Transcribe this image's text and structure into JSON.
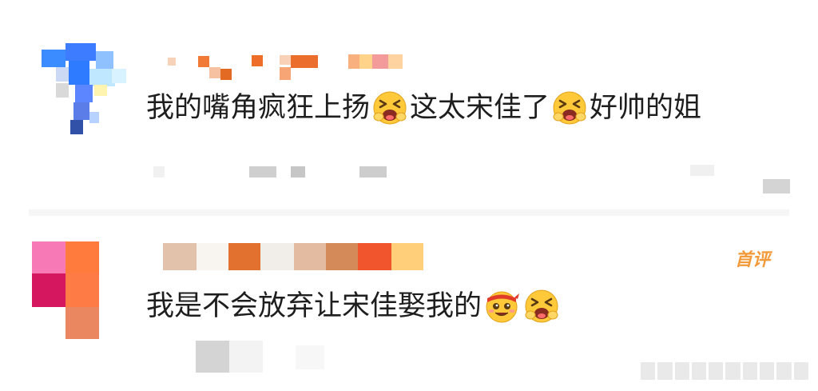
{
  "comments": [
    {
      "text_a": "我的嘴角疯狂上扬",
      "emoji_a": "grin-squint-icon",
      "text_b": "这太宋佳了",
      "emoji_b": "grin-squint-icon",
      "text_c": "好帅的姐"
    },
    {
      "badge": "首评",
      "text_a": "我是不会放弃让宋佳娶我的",
      "emoji_a": "headband-smile-icon",
      "emoji_b": "grin-squint-icon"
    }
  ],
  "colors": {
    "text": "#1e1e1e",
    "badge": "#f39a3b",
    "emoji_face": "#ffc93a"
  }
}
